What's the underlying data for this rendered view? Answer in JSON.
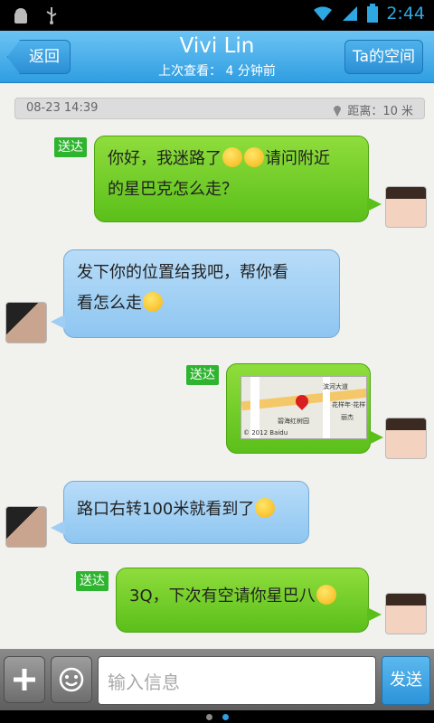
{
  "status_bar": {
    "time": "2:44"
  },
  "header": {
    "back_label": "返回",
    "title": "Vivi Lin",
    "subtitle": "上次查看： 4 分钟前",
    "space_label": "Ta的空间"
  },
  "info": {
    "date": "08-23 14:39",
    "distance": "距离：10 米"
  },
  "messages": [
    {
      "status": "送达",
      "line1": "你好，我迷路了",
      "line1b": "请问附近",
      "line2": "的星巴克怎么走？"
    },
    {
      "line1": "发下你的位置给我吧，帮你看",
      "line2": "看怎么走"
    },
    {
      "status": "送达",
      "map_copyright": "© 2012 Baidu",
      "map_road": "滨河大道",
      "map_poi1": "花样年·花样",
      "map_poi2": "碧海红树园",
      "map_poi3": "丽杰"
    },
    {
      "line1": "路口右转100米就看到了"
    },
    {
      "status": "送达",
      "line1": "3Q，下次有空请你星巴八"
    }
  ],
  "input": {
    "placeholder": "输入信息",
    "send_label": "发送"
  },
  "colors": {
    "accent": "#2f9ee2",
    "sent_green": "#5bbf1a",
    "received_blue": "#8ec6f1"
  }
}
